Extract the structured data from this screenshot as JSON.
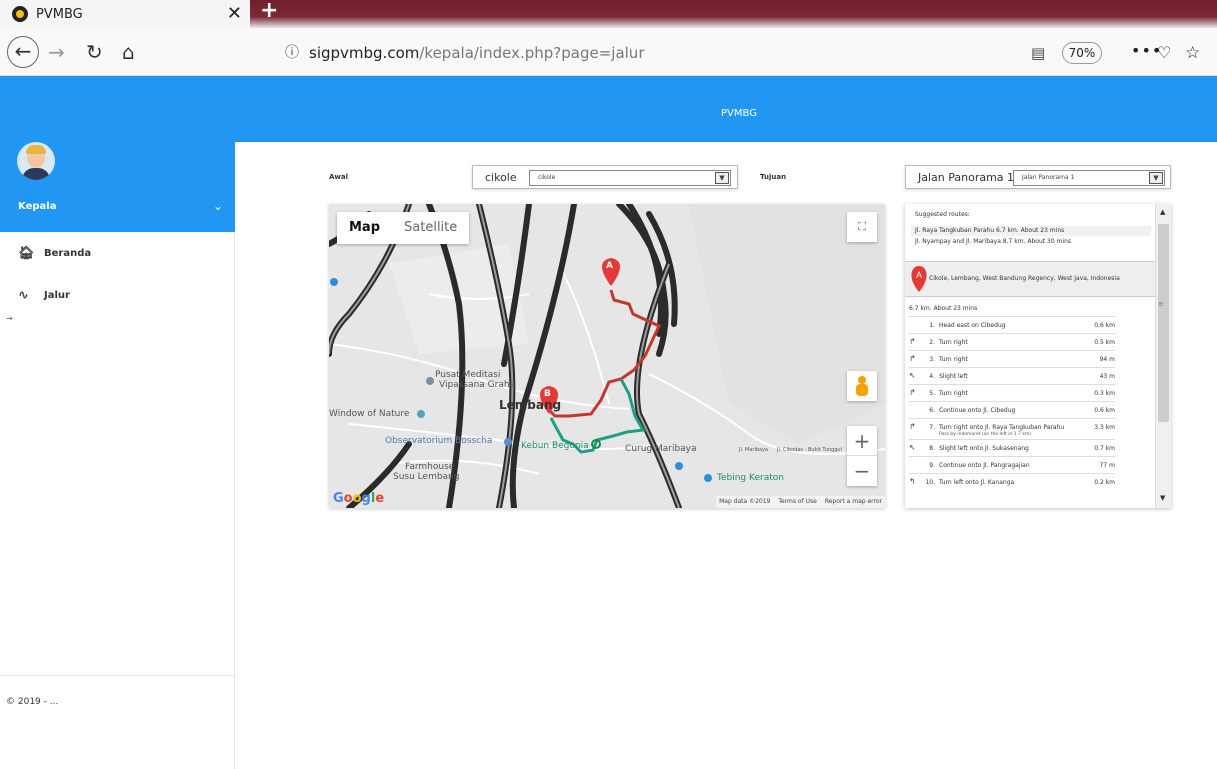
{
  "browser": {
    "tab_title": "PVMBG",
    "tab_close": "✕",
    "new_tab": "+",
    "url_host": "sigpvmbg.com",
    "url_path": "/kepala/index.php?page=jalur",
    "zoom": "70%"
  },
  "app": {
    "title": "PVMBG"
  },
  "sidebar": {
    "role": "Kepala",
    "items": [
      {
        "label": "Beranda",
        "icon": "home-icon"
      },
      {
        "label": "Jalur",
        "icon": "route-icon"
      }
    ],
    "footer": "© 2019 - ..."
  },
  "form": {
    "awal_label": "Awal",
    "awal_value": "cikole",
    "awal_option": "cikole",
    "tujuan_label": "Tujuan",
    "tujuan_value": "Jalan Panorama 1",
    "tujuan_option": "Jalan Panorama 1"
  },
  "map": {
    "tab_map": "Map",
    "tab_satellite": "Satellite",
    "labels": {
      "pusat": "Pusat Meditasi",
      "vipassana": "Vipassana Graha",
      "window": "Window of Nature",
      "observatorium": "Observatorium Bosscha",
      "lembang": "Lembang",
      "kebun": "Kebun Begonia",
      "curug": "Curug Maribaya",
      "farmhouse": "Farmhouse",
      "susu": "Susu Lembang",
      "tebing": "Tebing Keraton",
      "maribaya_road": "Jl. Maribaya",
      "cibodas_road": "Jl. Cibodas - Bukit Tunggul"
    },
    "marker_a": "A",
    "marker_b": "B",
    "attribution": [
      "Map data ©2019",
      "Terms of Use",
      "Report a map error"
    ]
  },
  "directions": {
    "suggested_title": "Suggested routes:",
    "routes": [
      "Jl. Raya Tangkuban Parahu 6.7 km. About 23 mins",
      "Jl. Nyampay and Jl. Maribaya 8.7 km. About 30 mins"
    ],
    "start_marker": "A",
    "start_address": "Cikole, Lembang, West Bandung Regency, West Java, Indonesia",
    "summary": "6.7 km. About 23 mins",
    "steps": [
      {
        "icon": "",
        "num": "1.",
        "text": "Head east on Cibedug",
        "dist": "0.6 km"
      },
      {
        "icon": "↱",
        "num": "2.",
        "text": "Turn right",
        "dist": "0.5 km"
      },
      {
        "icon": "↱",
        "num": "3.",
        "text": "Turn right",
        "dist": "94 m"
      },
      {
        "icon": "↖",
        "num": "4.",
        "text": "Slight left",
        "dist": "43 m"
      },
      {
        "icon": "↱",
        "num": "5.",
        "text": "Turn right",
        "dist": "0.3 km"
      },
      {
        "icon": "",
        "num": "6.",
        "text": "Continue onto Jl. Cibedug",
        "dist": "0.6 km"
      },
      {
        "icon": "↱",
        "num": "7.",
        "text": "Turn right onto Jl. Raya Tangkuban Parahu",
        "note": "Pass by indomaret (on the left in 1.7 km)",
        "dist": "3.3 km"
      },
      {
        "icon": "↖",
        "num": "8.",
        "text": "Slight left onto Jl. Sukasenang",
        "dist": "0.7 km"
      },
      {
        "icon": "",
        "num": "9.",
        "text": "Continue onto Jl. Pangragajian",
        "dist": "77 m"
      },
      {
        "icon": "↰",
        "num": "10.",
        "text": "Turn left onto Jl. Kananga",
        "dist": "0.2 km"
      }
    ]
  }
}
